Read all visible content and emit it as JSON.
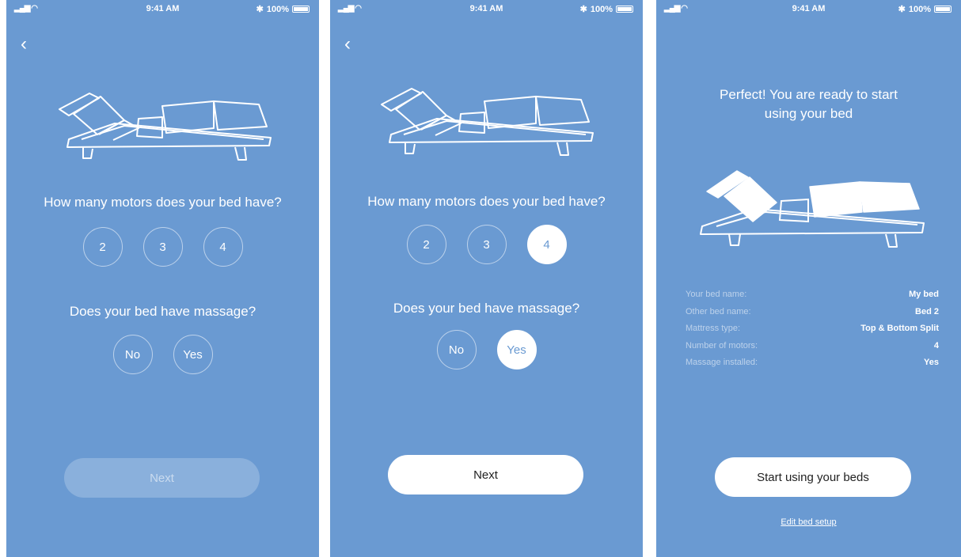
{
  "status_bar": {
    "time": "9:41 AM",
    "battery": "100%"
  },
  "screens": [
    {
      "motors_question": "How many motors does your bed have?",
      "motor_options": [
        "2",
        "3",
        "4"
      ],
      "massage_question": "Does your bed have massage?",
      "massage_options": [
        "No",
        "Yes"
      ],
      "next_label": "Next"
    },
    {
      "motors_question": "How many motors does your bed have?",
      "motor_options": [
        "2",
        "3",
        "4"
      ],
      "selected_motor": "4",
      "massage_question": "Does your bed have massage?",
      "massage_options": [
        "No",
        "Yes"
      ],
      "selected_massage": "Yes",
      "next_label": "Next"
    },
    {
      "heading_line1": "Perfect! You are ready to start",
      "heading_line2": "using your bed",
      "summary": [
        {
          "label": "Your bed name:",
          "value": "My bed"
        },
        {
          "label": "Other bed name:",
          "value": "Bed 2"
        },
        {
          "label": "Mattress type:",
          "value": "Top & Bottom Split"
        },
        {
          "label": "Number of motors:",
          "value": "4"
        },
        {
          "label": "Massage installed:",
          "value": "Yes"
        }
      ],
      "start_label": "Start using your beds",
      "edit_label": "Edit bed setup"
    }
  ],
  "colors": {
    "background": "#6a9ad2",
    "button": "#ffffff"
  },
  "icons": [
    "signal-icon",
    "bluetooth-icon",
    "battery-icon",
    "back-chevron-icon",
    "bed-illustration"
  ]
}
